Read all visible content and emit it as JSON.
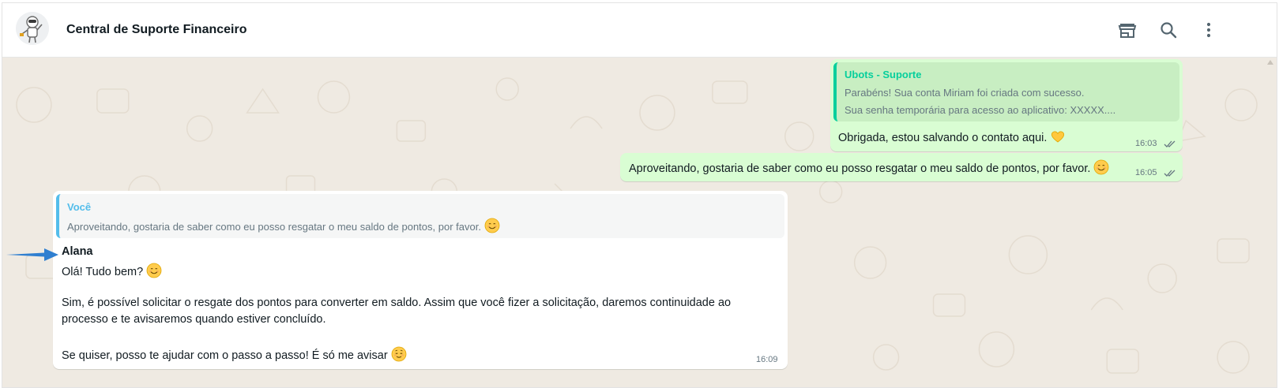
{
  "header": {
    "title": "Central de Suporte Financeiro",
    "icons": [
      "store-icon",
      "search-icon",
      "more-vertical-icon"
    ]
  },
  "messages": {
    "m1": {
      "quote_author": "Ubots - Suporte",
      "quote_line1": "Parabéns! Sua conta Miriam foi criada com sucesso.",
      "quote_line2": "Sua senha temporária para acesso ao aplicativo: XXXXX....",
      "text": "Obrigada, estou salvando o contato aqui.",
      "emoji": "yellow-heart-emoji",
      "time": "16:03"
    },
    "m2": {
      "text": "Aproveitando, gostaria de saber como eu posso resgatar o meu saldo de pontos, por favor.",
      "emoji": "smiling-face-emoji",
      "time": "16:05"
    },
    "m3": {
      "quote_author": "Você",
      "quote_text": "Aproveitando, gostaria de saber como eu posso resgatar o meu saldo de pontos, por favor.",
      "sender": "Alana",
      "line1": "Olá! Tudo bem?",
      "para1": "Sim, é possível solicitar o resgate dos pontos para converter em saldo. Assim que você fizer a solicitação, daremos continuidade ao",
      "para2": "processo e te avisaremos quando estiver concluído.",
      "para3": "Se quiser, posso te ajudar com o passo a passo! É só me avisar",
      "time": "16:09"
    }
  },
  "colors": {
    "chat_bg": "#efeae2",
    "outgoing_bubble": "#d9fdd3",
    "incoming_bubble": "#ffffff",
    "quote_green": "#06cf9c",
    "quote_blue": "#53bdeb",
    "annotation_arrow": "#2f7fd0"
  }
}
